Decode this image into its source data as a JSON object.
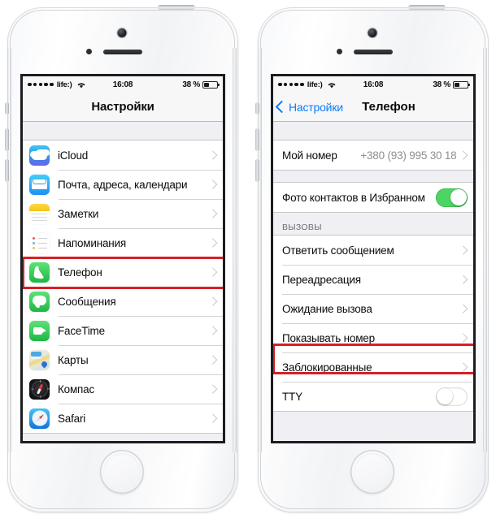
{
  "status_bar": {
    "signal_dots": 5,
    "carrier": "life:)",
    "wifi_icon": "wifi-icon",
    "time": "16:08",
    "battery_percent": "38 %",
    "battery_level": 38
  },
  "left_phone": {
    "nav": {
      "title": "Настройки"
    },
    "items": [
      {
        "label": "iCloud",
        "icon": "icloud-icon",
        "accessory": "chevron"
      },
      {
        "label": "Почта, адреса, календари",
        "icon": "mail-icon",
        "accessory": "chevron"
      },
      {
        "label": "Заметки",
        "icon": "notes-icon",
        "accessory": "chevron"
      },
      {
        "label": "Напоминания",
        "icon": "reminders-icon",
        "accessory": "chevron"
      },
      {
        "label": "Телефон",
        "icon": "phone-icon",
        "accessory": "chevron",
        "highlighted": true
      },
      {
        "label": "Сообщения",
        "icon": "messages-icon",
        "accessory": "chevron"
      },
      {
        "label": "FaceTime",
        "icon": "facetime-icon",
        "accessory": "chevron"
      },
      {
        "label": "Карты",
        "icon": "maps-icon",
        "accessory": "chevron"
      },
      {
        "label": "Компас",
        "icon": "compass-icon",
        "accessory": "chevron"
      },
      {
        "label": "Safari",
        "icon": "safari-icon",
        "accessory": "chevron"
      }
    ]
  },
  "right_phone": {
    "nav": {
      "back_label": "Настройки",
      "title": "Телефон",
      "back_icon": "chevron-left-icon"
    },
    "my_number": {
      "label": "Мой номер",
      "value": "+380 (93) 995 30 18",
      "accessory": "chevron"
    },
    "contact_photo": {
      "label": "Фото контактов в Избранном",
      "toggle": "on"
    },
    "calls_section": {
      "header": "ВЫЗОВЫ",
      "items": [
        {
          "label": "Ответить сообщением",
          "accessory": "chevron"
        },
        {
          "label": "Переадресация",
          "accessory": "chevron"
        },
        {
          "label": "Ожидание вызова",
          "accessory": "chevron"
        },
        {
          "label": "Показывать номер",
          "accessory": "chevron",
          "highlighted": true
        },
        {
          "label": "Заблокированные",
          "accessory": "chevron"
        },
        {
          "label": "TTY",
          "toggle": "off"
        }
      ]
    }
  },
  "colors": {
    "highlight_red": "#d91f26",
    "ios_blue": "#0a7cff",
    "toggle_green": "#4cd562",
    "group_bg": "#efeff4",
    "separator": "#d3d3d6"
  }
}
